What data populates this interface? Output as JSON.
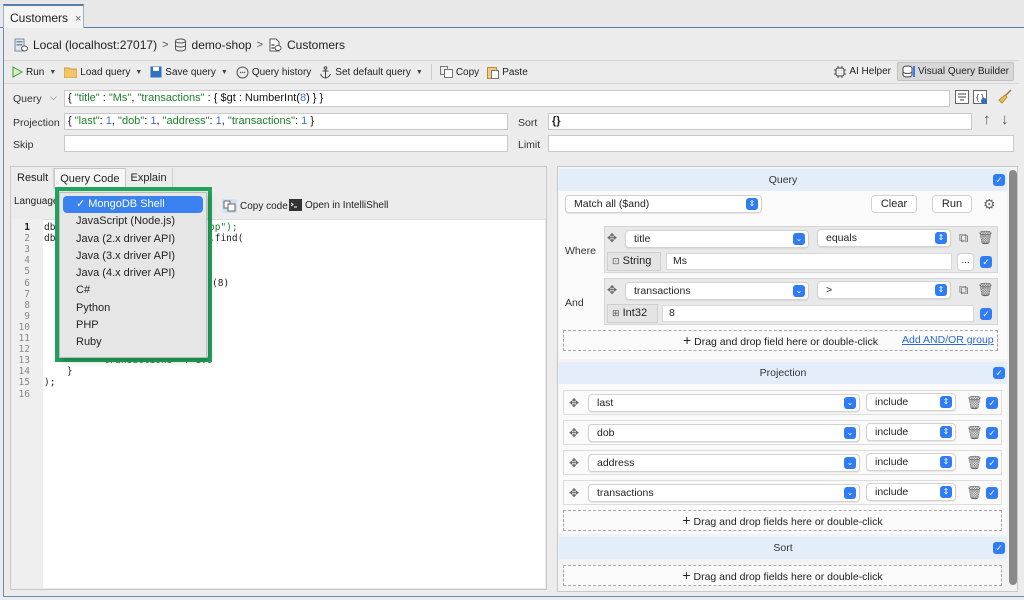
{
  "tab": {
    "title": "Customers",
    "close_icon": "×"
  },
  "breadcrumb": [
    {
      "label": "Local (localhost:27017)",
      "icon": "server-icon"
    },
    {
      "label": "demo-shop",
      "icon": "database-icon"
    },
    {
      "label": "Customers",
      "icon": "collection-icon"
    }
  ],
  "breadcrumb_sep": ">",
  "toolbar": {
    "run": "Run",
    "load_query": "Load query",
    "save_query": "Save query",
    "query_history": "Query history",
    "set_default_query": "Set default query",
    "copy": "Copy",
    "paste": "Paste",
    "ai_helper": "AI Helper",
    "visual_query_builder": "Visual Query Builder"
  },
  "form": {
    "query_label": "Query",
    "query_parts": [
      "{ ",
      "\"title\"",
      " : ",
      "\"Ms\"",
      ", ",
      "\"transactions\"",
      " : { $gt : NumberInt(",
      "8",
      ") } }"
    ],
    "projection_label": "Projection",
    "projection_parts": [
      "{ ",
      "\"last\"",
      ": ",
      "1",
      ", ",
      "\"dob\"",
      ": ",
      "1",
      ", ",
      "\"address\"",
      ": ",
      "1",
      ", ",
      "\"transactions\"",
      ": ",
      "1",
      " }"
    ],
    "sort_label": "Sort",
    "sort_value": "{}",
    "skip_label": "Skip",
    "skip_value": "",
    "limit_label": "Limit",
    "limit_value": ""
  },
  "result_tabs": [
    {
      "label": "Result",
      "active": false
    },
    {
      "label": "Query Code",
      "active": true
    },
    {
      "label": "Explain",
      "active": false
    }
  ],
  "code_toolbar": {
    "language_label": "Language",
    "copy_code": "Copy code",
    "open_intellishell": "Open in IntelliShell"
  },
  "language_menu": {
    "selected": "MongoDB Shell",
    "options": [
      "MongoDB Shell",
      "JavaScript (Node.js)",
      "Java (2.x driver API)",
      "Java (3.x driver API)",
      "Java (4.x driver API)",
      "C#",
      "Python",
      "PHP",
      "Ruby"
    ],
    "check": "✓"
  },
  "code": {
    "line_numbers": [
      "1",
      "2",
      "3",
      "4",
      "5",
      "6",
      "7",
      "8",
      "9",
      "10",
      "11",
      "12",
      "13",
      "14",
      "15",
      "16"
    ],
    "visible_fragments": [
      {
        "line": 1,
        "text": "db",
        "tail": "op\");"
      },
      {
        "line": 2,
        "text": "db",
        "tail": ".find("
      },
      {
        "line": 6,
        "text": "",
        "tail": "(8)"
      },
      {
        "line": 13,
        "text": "",
        "tail": "\"transactions\" : 1.0"
      },
      {
        "line": 14,
        "text": "    }",
        "tail": ""
      },
      {
        "line": 15,
        "text": ");",
        "tail": ""
      }
    ]
  },
  "vqb": {
    "query_section": {
      "title": "Query",
      "match_mode": "Match all ($and)",
      "clear": "Clear",
      "run": "Run",
      "conditions": [
        {
          "label": "Where",
          "field": "title",
          "operator": "equals",
          "type": "String",
          "value": "Ms",
          "has_ellipsis": true
        },
        {
          "label": "And",
          "field": "transactions",
          "operator": ">",
          "type": "Int32",
          "value": "8",
          "has_ellipsis": false
        }
      ],
      "drop_hint": "Drag and drop field here or double-click",
      "add_group_link": "Add AND/OR group",
      "ellipsis": "..."
    },
    "projection_section": {
      "title": "Projection",
      "rows": [
        {
          "field": "last",
          "mode": "include"
        },
        {
          "field": "dob",
          "mode": "include"
        },
        {
          "field": "address",
          "mode": "include"
        },
        {
          "field": "transactions",
          "mode": "include"
        }
      ],
      "drop_hint": "Drag and drop fields here or double-click"
    },
    "sort_section": {
      "title": "Sort",
      "drop_hint": "Drag and drop fields here or double-click"
    }
  },
  "colors": {
    "accent": "#2f7cf6",
    "highlight_border": "#21a55c",
    "json_key": "#1e7f2a",
    "json_number": "#3a6fd8"
  }
}
